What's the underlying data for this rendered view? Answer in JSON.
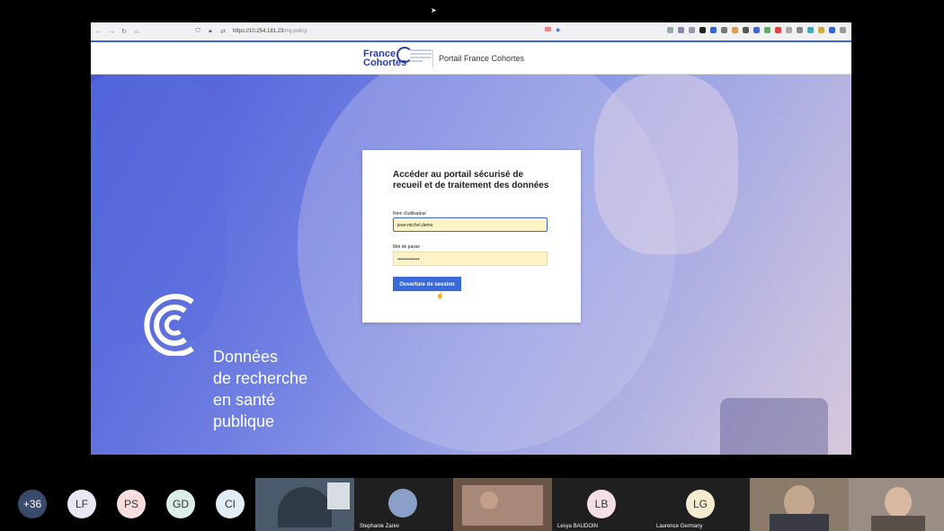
{
  "browser": {
    "url_host": "https://10.254.181.23",
    "url_path": "/my.policy"
  },
  "header": {
    "logo_line1": "France",
    "logo_line2": "Cohortes",
    "portal_title": "Portail France Cohortes"
  },
  "hero": {
    "tagline_lines": [
      "Données",
      "de recherche",
      "en santé",
      "publique"
    ]
  },
  "login": {
    "title": "Accéder au portail sécurisé de recueil et de traitement des données",
    "username_label": "Nom d'utilisateur",
    "username_value": "jean-michel.demo",
    "password_label": "Mot de passe",
    "password_value": "••••••••••••••",
    "submit_label": "Ouverture de session"
  },
  "participants": {
    "more_count": "+36",
    "bubbles": [
      {
        "initials": "LF",
        "color": "#e8e8f4"
      },
      {
        "initials": "PS",
        "color": "#f6dede"
      },
      {
        "initials": "GD",
        "color": "#dcefe6"
      },
      {
        "initials": "CI",
        "color": "#e2ecf4"
      }
    ],
    "tiles": [
      {
        "name": "",
        "type": "video",
        "color": "#4a5a6a"
      },
      {
        "name": "Stephanie Zarev",
        "type": "avatar",
        "color": "#1f1f1f"
      },
      {
        "name": "",
        "type": "video",
        "color": "#6a5448"
      },
      {
        "name": "Lesya BAUDOIN",
        "type": "initials",
        "initials": "LB",
        "color": "#1f1f1f",
        "bubble": "#f4dee8"
      },
      {
        "name": "Laurence Germany",
        "type": "initials",
        "initials": "LG",
        "color": "#1f1f1f",
        "bubble": "#f4ecd0"
      },
      {
        "name": "",
        "type": "video",
        "color": "#8a7a6a"
      },
      {
        "name": "",
        "type": "video",
        "color": "#9a8e84"
      }
    ]
  },
  "colors": {
    "accent": "#3a6ad8",
    "brand": "#2a3eb1"
  }
}
